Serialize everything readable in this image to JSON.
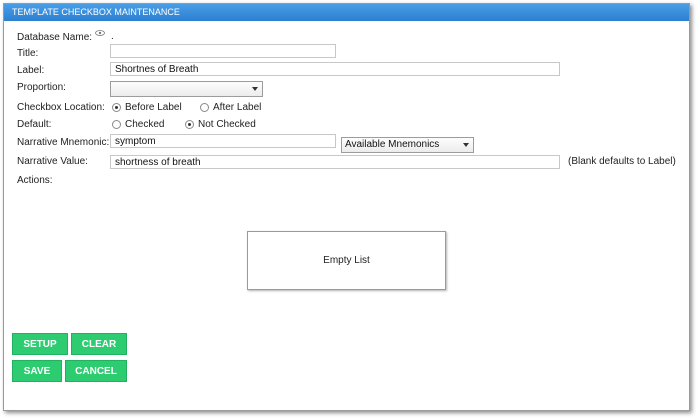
{
  "window": {
    "title": "TEMPLATE CHECKBOX MAINTENANCE"
  },
  "form": {
    "database_name_label": "Database Name:",
    "database_name_value": ".",
    "title_label": "Title:",
    "title_value": "",
    "label_label": "Label:",
    "label_value": "Shortnes of Breath",
    "proportion_label": "Proportion:",
    "proportion_value": "",
    "checkbox_location_label": "Checkbox Location:",
    "before_label": "Before Label",
    "after_label": "After Label",
    "checkbox_location_selected": "Before Label",
    "default_label": "Default:",
    "checked_label": "Checked",
    "not_checked_label": "Not Checked",
    "default_selected": "Not Checked",
    "mnemonic_label": "Narrative Mnemonic:",
    "mnemonic_value": "symptom",
    "mnemonic_select": "Available Mnemonics",
    "narrative_value_label": "Narrative Value:",
    "narrative_value": "shortness of breath",
    "narrative_hint": "(Blank defaults to Label)",
    "actions_label": "Actions:",
    "actions_empty": "Empty List"
  },
  "buttons": {
    "setup": "SETUP",
    "clear": "CLEAR",
    "save": "SAVE",
    "cancel": "CANCEL"
  },
  "colors": {
    "titlebar": "#2b7fd0",
    "button": "#2ecc71"
  },
  "icons": {
    "database_name": "eye-icon"
  }
}
